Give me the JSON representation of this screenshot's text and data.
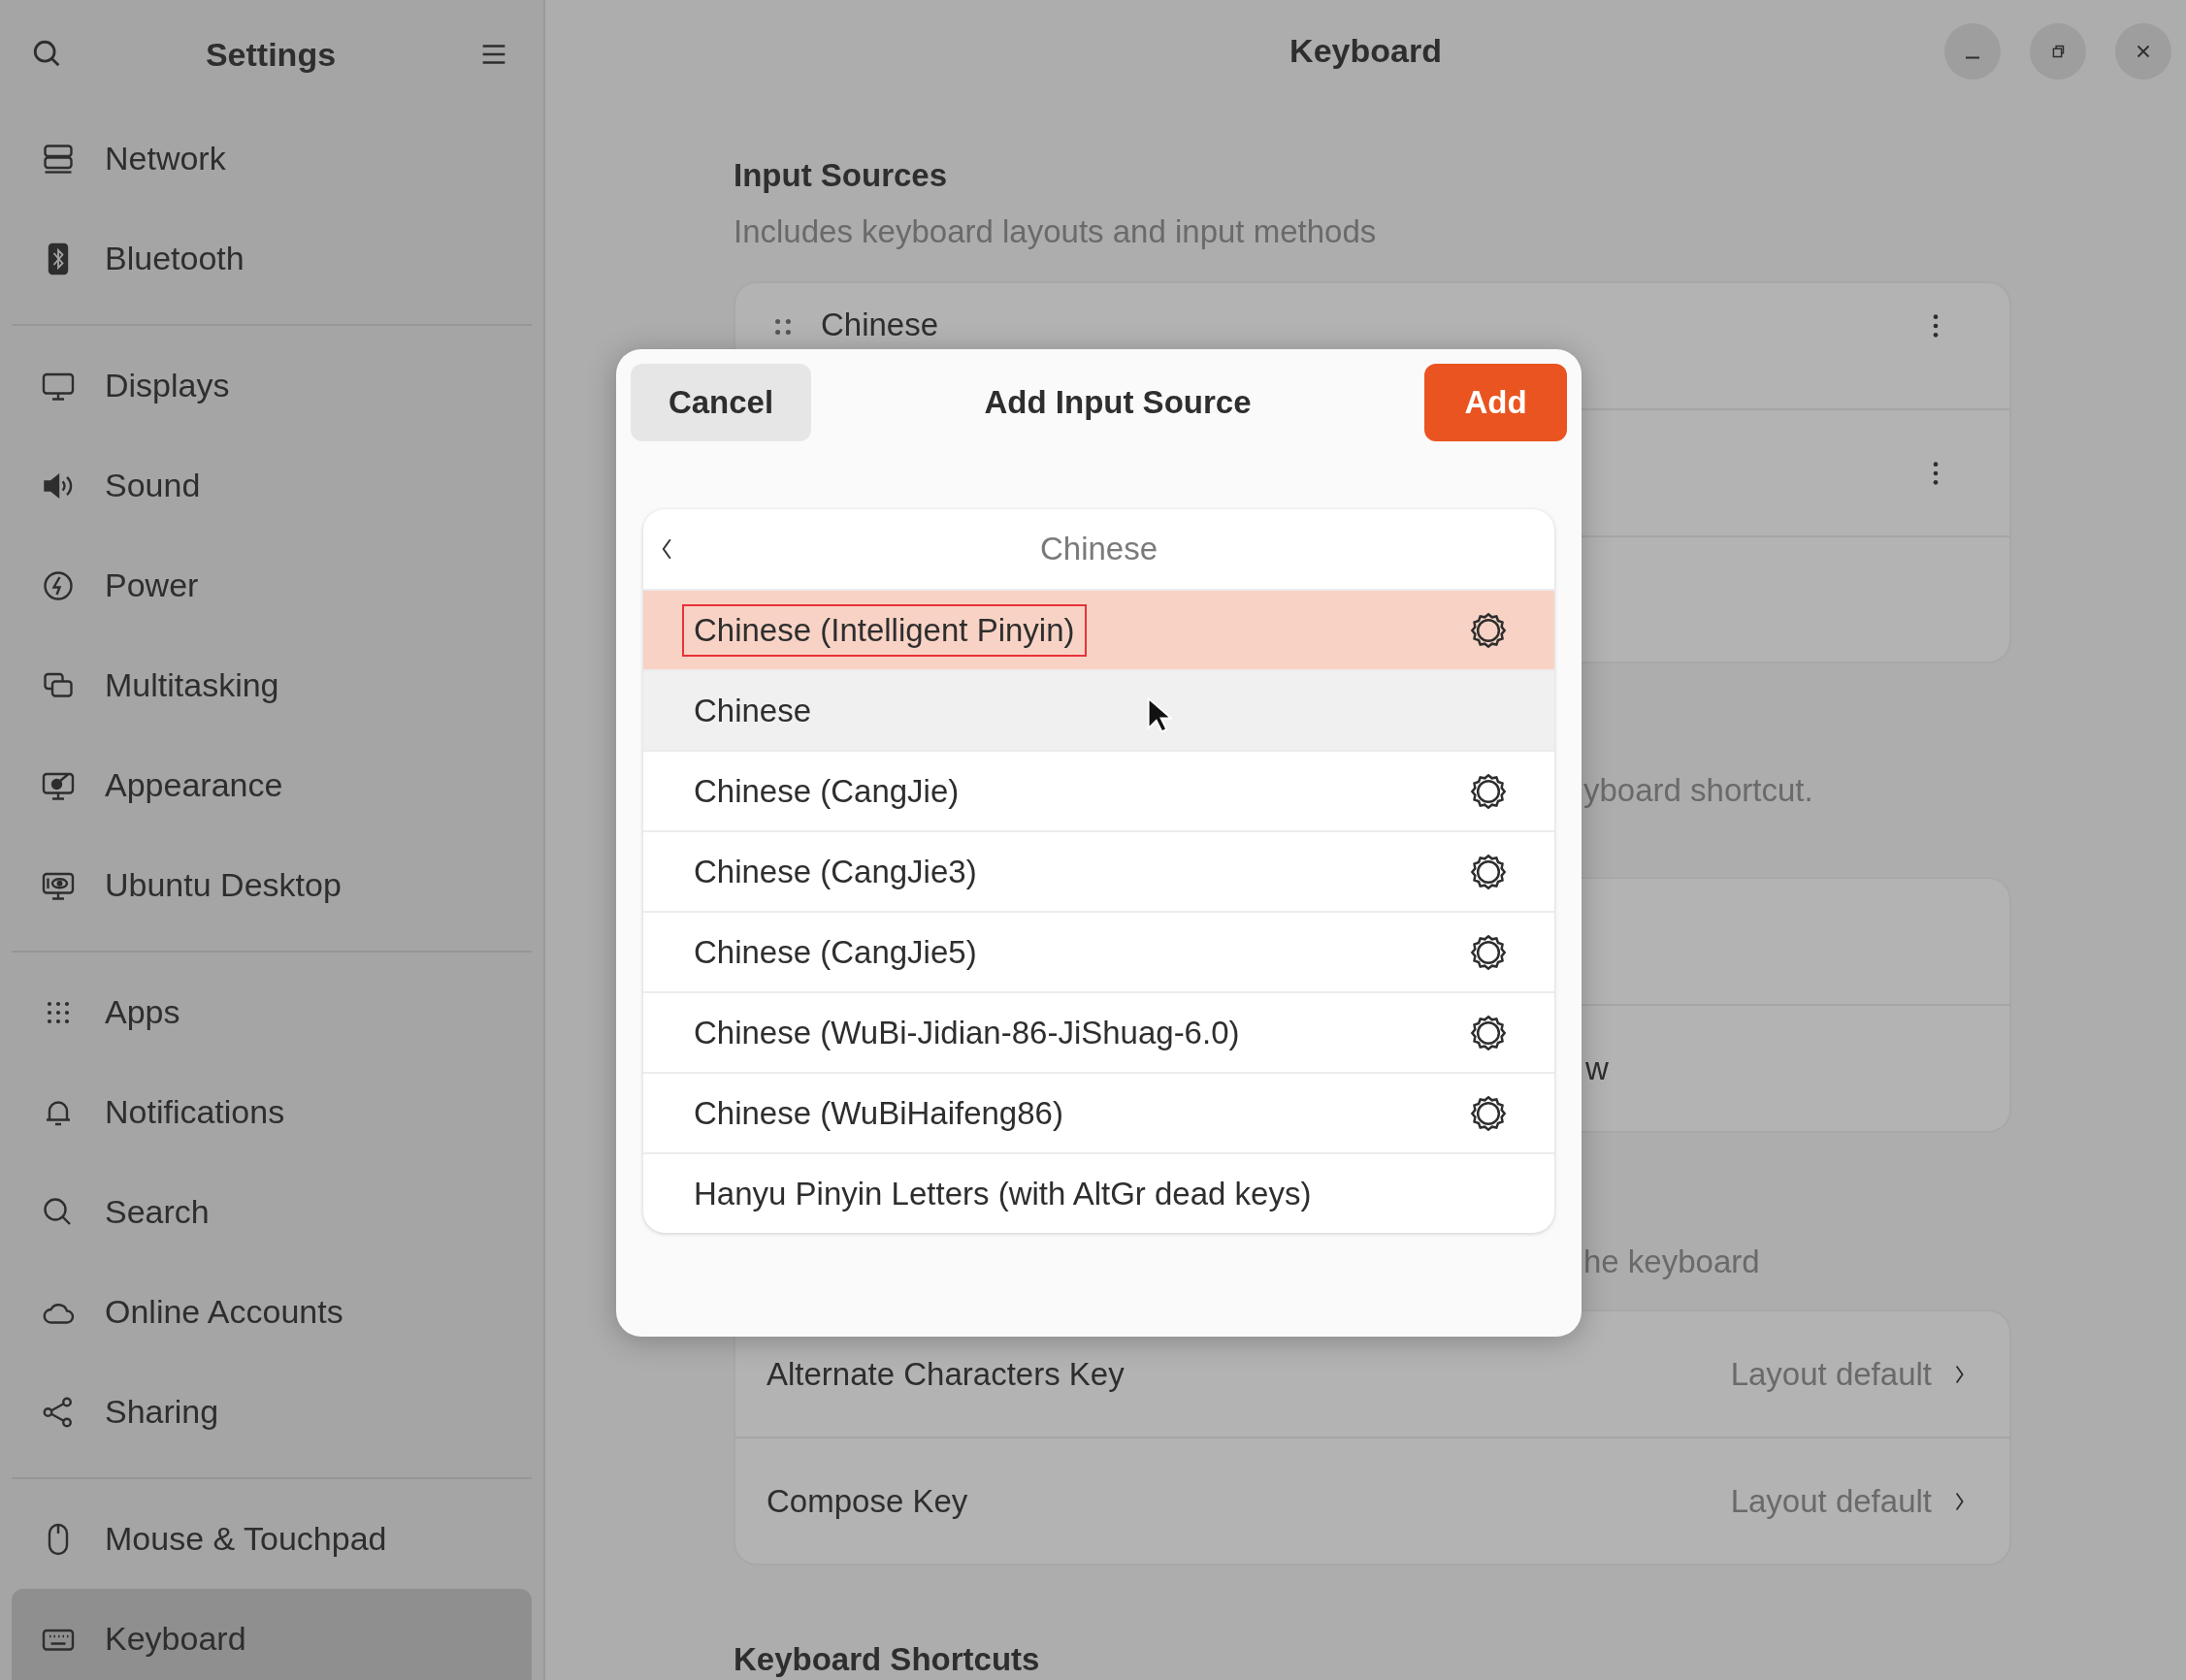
{
  "sidebar": {
    "title": "Settings",
    "groups": [
      [
        {
          "label": "Network",
          "selected": false
        },
        {
          "label": "Bluetooth",
          "selected": false
        }
      ],
      [
        {
          "label": "Displays",
          "selected": false
        },
        {
          "label": "Sound",
          "selected": false
        },
        {
          "label": "Power",
          "selected": false
        },
        {
          "label": "Multitasking",
          "selected": false
        },
        {
          "label": "Appearance",
          "selected": false
        },
        {
          "label": "Ubuntu Desktop",
          "selected": false
        }
      ],
      [
        {
          "label": "Apps",
          "selected": false
        },
        {
          "label": "Notifications",
          "selected": false
        },
        {
          "label": "Search",
          "selected": false
        },
        {
          "label": "Online Accounts",
          "selected": false
        },
        {
          "label": "Sharing",
          "selected": false
        }
      ],
      [
        {
          "label": "Mouse & Touchpad",
          "selected": false
        },
        {
          "label": "Keyboard",
          "selected": true
        }
      ]
    ]
  },
  "window": {
    "title": "Keyboard"
  },
  "input_sources": {
    "heading": "Input Sources",
    "description": "Includes keyboard layouts and input methods",
    "rows": [
      {
        "kind": "source",
        "label": "Chinese"
      },
      {
        "kind": "source"
      },
      {
        "kind": "blank"
      }
    ]
  },
  "switching": {
    "description": "yboard shortcut.",
    "rows": [
      {},
      {
        "label": "w"
      }
    ]
  },
  "special_keys": {
    "description": "he keyboard",
    "rows": [
      {
        "label": "Alternate Characters Key",
        "value": "Layout default"
      },
      {
        "label": "Compose Key",
        "value": "Layout default"
      }
    ]
  },
  "shortcuts": {
    "heading": "Keyboard Shortcuts"
  },
  "dialog": {
    "title": "Add Input Source",
    "cancel": "Cancel",
    "add": "Add",
    "list_title": "Chinese",
    "items": [
      {
        "label": "Chinese (Intelligent Pinyin)",
        "settings": true,
        "selected": true,
        "hovered": false,
        "outlined": true
      },
      {
        "label": "Chinese",
        "settings": false,
        "selected": false,
        "hovered": true,
        "outlined": false
      },
      {
        "label": "Chinese (CangJie)",
        "settings": true,
        "selected": false,
        "hovered": false,
        "outlined": false
      },
      {
        "label": "Chinese (CangJie3)",
        "settings": true,
        "selected": false,
        "hovered": false,
        "outlined": false
      },
      {
        "label": "Chinese (CangJie5)",
        "settings": true,
        "selected": false,
        "hovered": false,
        "outlined": false
      },
      {
        "label": "Chinese (WuBi-Jidian-86-JiShuag-6.0)",
        "settings": true,
        "selected": false,
        "hovered": false,
        "outlined": false
      },
      {
        "label": "Chinese (WuBiHaifeng86)",
        "settings": true,
        "selected": false,
        "hovered": false,
        "outlined": false
      },
      {
        "label": "Hanyu Pinyin Letters (with AltGr dead keys)",
        "settings": false,
        "selected": false,
        "hovered": false,
        "outlined": false
      }
    ]
  }
}
